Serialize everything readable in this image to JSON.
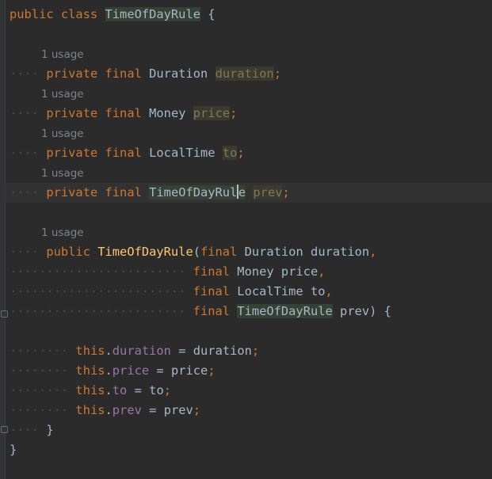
{
  "editor": {
    "class_decl": {
      "kw1": "public",
      "kw2": "class",
      "name": "TimeOfDayRule",
      "brace": "{"
    },
    "usage_hint": "1 usage",
    "fields": [
      {
        "kw1": "private",
        "kw2": "final",
        "type": "Duration",
        "name": "duration",
        "end": ";"
      },
      {
        "kw1": "private",
        "kw2": "final",
        "type": "Money",
        "name": "price",
        "end": ";"
      },
      {
        "kw1": "private",
        "kw2": "final",
        "type": "LocalTime",
        "name": "to",
        "end": ";"
      },
      {
        "kw1": "private",
        "kw2": "final",
        "type": "TimeOfDayRul",
        "type_tail": "e",
        "name": "prev",
        "end": ";"
      }
    ],
    "constructor": {
      "kw": "public",
      "name": "TimeOfDayRule",
      "open_paren": "(",
      "params": [
        {
          "kw": "final",
          "type": "Duration",
          "name": "duration",
          "end": ","
        },
        {
          "kw": "final",
          "type": "Money",
          "name": "price",
          "end": ","
        },
        {
          "kw": "final",
          "type": "LocalTime",
          "name": "to",
          "end": ","
        },
        {
          "kw": "final",
          "type": "TimeOfDayRule",
          "name": "prev",
          "end": ") {"
        }
      ],
      "body": [
        {
          "this": "this",
          "dot": ".",
          "field": "duration",
          "eq": "=",
          "value": "duration",
          "end": ";"
        },
        {
          "this": "this",
          "dot": ".",
          "field": "price",
          "eq": "=",
          "value": "price",
          "end": ";"
        },
        {
          "this": "this",
          "dot": ".",
          "field": "to",
          "eq": "=",
          "value": "to",
          "end": ";"
        },
        {
          "this": "this",
          "dot": ".",
          "field": "prev",
          "eq": "=",
          "value": "prev",
          "end": ";"
        }
      ],
      "close": "}"
    },
    "class_close": "}"
  }
}
